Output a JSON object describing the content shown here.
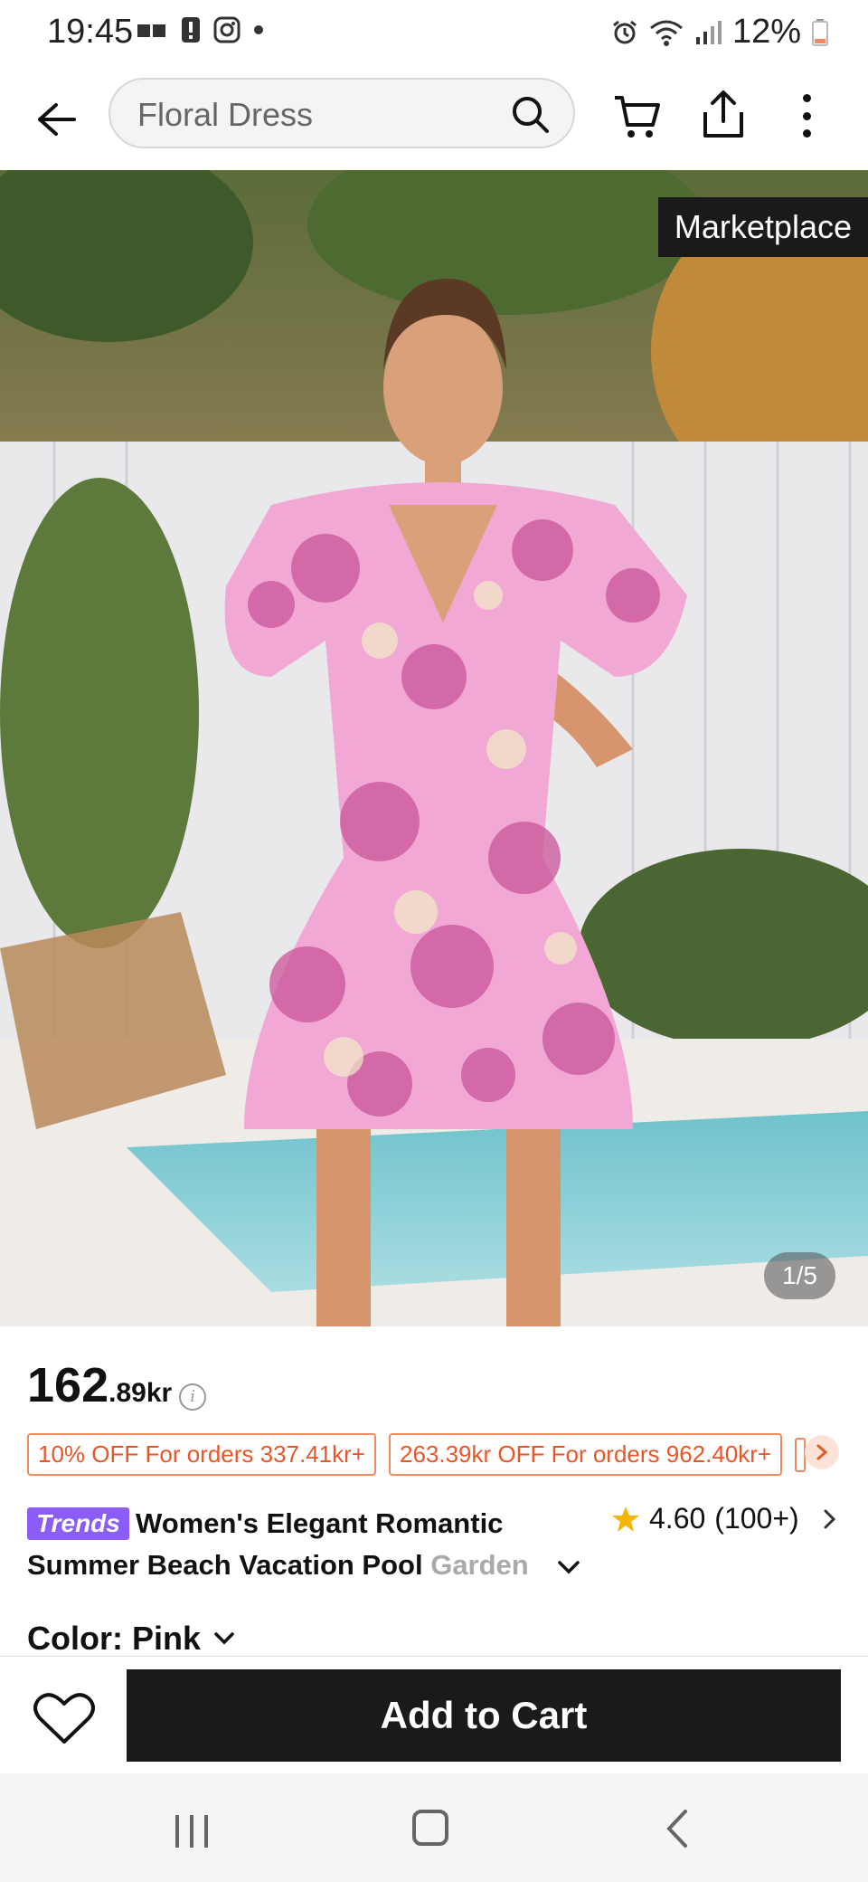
{
  "status_bar": {
    "time": "19:45",
    "battery": "12%",
    "icons": [
      "network-icon",
      "alert-icon",
      "instagram-icon",
      "dot-icon",
      "alarm-icon",
      "wifi-icon",
      "signal-icon",
      "battery-icon"
    ]
  },
  "top_bar": {
    "search_value": "Floral Dress",
    "icons": [
      "back-arrow-icon",
      "search-icon",
      "cart-icon",
      "share-icon",
      "more-vertical-icon"
    ]
  },
  "hero": {
    "badge": "Marketplace",
    "counter": "1/5"
  },
  "product": {
    "price_int": "162",
    "price_dec": ".89",
    "currency": "kr",
    "coupons": [
      "10% OFF For orders 337.41kr+",
      "263.39kr OFF For orders 962.40kr+"
    ],
    "badge": "Trends",
    "title_line1": "Women's Elegant Romantic",
    "title_line2": "Summer Beach Vacation Pool ",
    "title_fade": "Garden",
    "rating": "4.60",
    "rating_count": "(100+)",
    "color_label": "Color: Pink"
  },
  "actions": {
    "add_to_cart": "Add to Cart"
  },
  "colors": {
    "accent_coupon": "#e8562a",
    "trends_badge": "#8b5cf6",
    "star": "#f5b400",
    "cta_bg": "#1a1a1a"
  }
}
